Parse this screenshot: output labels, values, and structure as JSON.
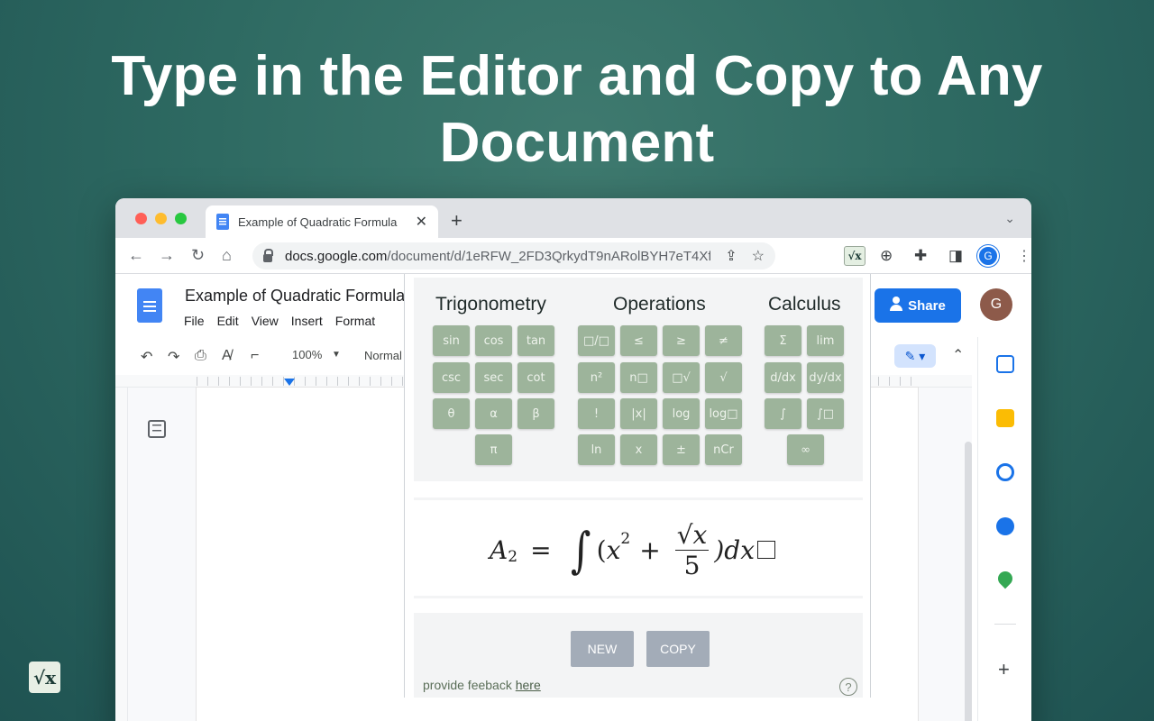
{
  "headline": "Type in the Editor and Copy to Any Document",
  "colors": {
    "key": "#9db49b",
    "accent_blue": "#1a73e8",
    "button": "#a3acb8"
  },
  "browser": {
    "tab_title": "Example of Quadratic Formula",
    "tab_close": "✕",
    "new_tab": "+",
    "url_host": "docs.google.com",
    "url_path": "/document/d/1eRFW_2FD3QrkydT9nARolBYH7eT4XfA...",
    "profile_initial": "G",
    "extension_label": "√x"
  },
  "docs": {
    "title": "Example of Quadratic Formula",
    "menu": [
      "File",
      "Edit",
      "View",
      "Insert",
      "Format"
    ],
    "share_label": "Share",
    "avatar_initial": "G",
    "zoom": "100%",
    "style": "Normal"
  },
  "palette": {
    "headings": [
      "Trigonometry",
      "Operations",
      "Calculus"
    ],
    "trig_keys": [
      "sin",
      "cos",
      "tan",
      "csc",
      "sec",
      "cot",
      "θ",
      "α",
      "β",
      "π"
    ],
    "op_keys": [
      "□/□",
      "≤",
      "≥",
      "≠",
      "n²",
      "n□",
      "□√",
      "√",
      "!",
      "|x|",
      "log",
      "log□",
      "ln",
      "x",
      "±",
      "nCr"
    ],
    "calc_keys": [
      "Σ",
      "lim",
      "d/dx",
      "dy/dx",
      "∫",
      "∫□",
      "∞"
    ]
  },
  "formula": {
    "lhs": "A",
    "lhs_sub": "2",
    "equals": "=",
    "integral": "∫",
    "open": "(",
    "x": "x",
    "x_sup": "2",
    "plus": "+",
    "num": "√x",
    "den": "5",
    "close": ")dx"
  },
  "actions": {
    "new_label": "NEW",
    "copy_label": "COPY",
    "feedback_text": "provide feeback ",
    "feedback_link": "here",
    "help": "?"
  },
  "corner_logo": "√x"
}
